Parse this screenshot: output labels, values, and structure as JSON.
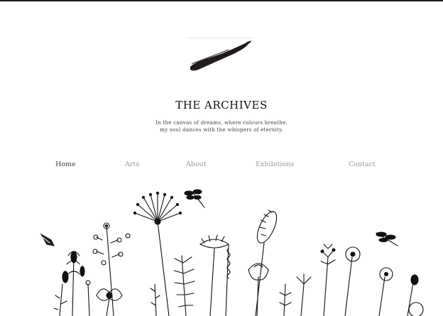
{
  "site": {
    "title": "THE ARCHIVES",
    "tagline_line1": "In the canvas of dreams, where colours breathe,",
    "tagline_line2": "my soul dances with the whispers of eternity."
  },
  "nav": {
    "items": [
      {
        "label": "Home",
        "active": true
      },
      {
        "label": "Arts",
        "active": false
      },
      {
        "label": "About",
        "active": false
      },
      {
        "label": "Exhibitions",
        "active": false
      },
      {
        "label": "Contact",
        "active": false
      }
    ]
  },
  "colors": {
    "text_dark": "#111111",
    "nav_active": "#444444",
    "nav_inactive": "#9a9a9a",
    "brush": "#1f1a1e"
  },
  "icons": {
    "logo": "brush-stroke-logo",
    "illustration": "wildflower-line-drawing"
  }
}
